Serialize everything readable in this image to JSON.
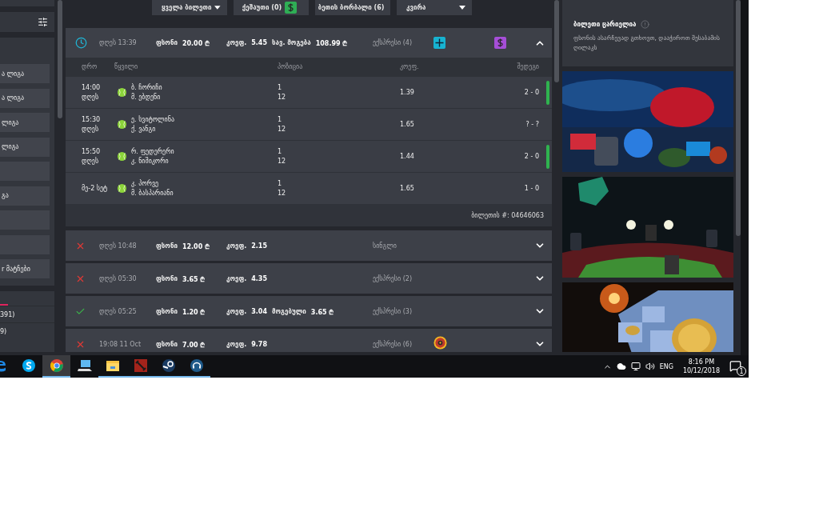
{
  "sidebar": {
    "items": [
      {
        "kind": "league",
        "label": "ა ლიგა"
      },
      {
        "kind": "league",
        "label": "ა ლიგა"
      },
      {
        "kind": "league",
        "label": "ლიგა"
      },
      {
        "kind": "league",
        "label": "ლიგა"
      },
      {
        "kind": "blank"
      },
      {
        "kind": "league",
        "label": "გა"
      },
      {
        "kind": "blank"
      },
      {
        "kind": "blank"
      },
      {
        "kind": "league",
        "label": "r მატჩები"
      }
    ],
    "list": [
      "391)",
      "9)"
    ]
  },
  "filters": [
    {
      "label": "ყველა ბილეთი",
      "kind": "dropdown"
    },
    {
      "label": "ქეშაუთი (0)",
      "kind": "cashout"
    },
    {
      "label": "ბეთის ბორბალი (6)",
      "kind": "plain"
    },
    {
      "label": "კვირა",
      "kind": "dropdown"
    }
  ],
  "tickets": [
    {
      "kind": "pending",
      "expanded": true,
      "date": "დღეს 13:39",
      "stake": {
        "label": "ფსონი",
        "value": "20.00 ₾"
      },
      "odds": {
        "label": "კოეფ.",
        "value": "5.45"
      },
      "payout": {
        "label": "სავ. მოგება",
        "value": "108.99 ₾"
      },
      "type": "ექსპრესი (4)",
      "can_add": true,
      "cashout": true,
      "bonus": false,
      "columns": [
        "დრო",
        "წყვილი",
        "პოზიცია",
        "კოეფ.",
        "შედეგი"
      ],
      "matches": [
        {
          "time": "14:00",
          "day": "დღეს",
          "home": "ბ. ჩორიჩი",
          "away": "მ. ებდენი",
          "pick": "1",
          "market": "12",
          "odds": "1.39",
          "result": "2 - 0",
          "won": true
        },
        {
          "time": "15:30",
          "day": "დღეს",
          "home": "ე. სვიტოლინა",
          "away": "ქ. ვანგი",
          "pick": "1",
          "market": "12",
          "odds": "1.65",
          "result": "? - ?",
          "won": false
        },
        {
          "time": "15:50",
          "day": "დღეს",
          "home": "რ. ფედერერი",
          "away": "კ. ნიშიკორი",
          "pick": "1",
          "market": "12",
          "odds": "1.44",
          "result": "2 - 0",
          "won": true
        },
        {
          "time": "მე-2 სეტ",
          "home": "კ. პორვე",
          "away": "მ. ბასპარიანი",
          "pick": "1",
          "market": "12",
          "odds": "1.65",
          "result": "1 - 0",
          "won": false
        }
      ],
      "footer": "ბილეთის #: 04646063"
    },
    {
      "kind": "lost",
      "expanded": false,
      "date": "დღეს 10:48",
      "stake": {
        "label": "ფსონი",
        "value": "12.00 ₾"
      },
      "odds": {
        "label": "კოეფ.",
        "value": "2.15"
      },
      "type": "სინგლი",
      "can_add": false,
      "cashout": false,
      "bonus": false
    },
    {
      "kind": "lost",
      "expanded": false,
      "date": "დღეს 05:30",
      "stake": {
        "label": "ფსონი",
        "value": "3.65 ₾"
      },
      "odds": {
        "label": "კოეფ.",
        "value": "4.35"
      },
      "type": "ექსპრესი (2)",
      "can_add": false,
      "cashout": false,
      "bonus": false
    },
    {
      "kind": "won",
      "expanded": false,
      "date": "დღეს 05:25",
      "stake": {
        "label": "ფსონი",
        "value": "1.20 ₾"
      },
      "odds": {
        "label": "კოეფ.",
        "value": "3.04"
      },
      "payout": {
        "label": "მოგებული",
        "value": "3.65 ₾"
      },
      "type": "ექსპრესი (3)",
      "can_add": false,
      "cashout": false,
      "bonus": false
    },
    {
      "kind": "lost",
      "expanded": false,
      "date": "19:08 11 Oct",
      "stake": {
        "label": "ფსონი",
        "value": "7.00 ₾"
      },
      "odds": {
        "label": "კოეფ.",
        "value": "9.78"
      },
      "type": "ექსპრესი (6)",
      "can_add": false,
      "cashout": false,
      "bonus": true
    }
  ],
  "betslip": {
    "title": "ბილეთი ცარიელია",
    "message": "ფსონის ასარჩევად გთხოვთ, დააჭიროთ შესაბამის ღილაკს"
  },
  "taskbar": {
    "apps": [
      {
        "selected": false,
        "running": false
      },
      {
        "selected": false,
        "running": false
      },
      {
        "selected": true,
        "running": true
      },
      {
        "selected": false,
        "running": false
      },
      {
        "selected": false,
        "running": true
      },
      {
        "selected": false,
        "running": true
      },
      {
        "selected": false,
        "running": true
      },
      {
        "selected": false,
        "running": true
      }
    ],
    "language": "ENG",
    "time": "8:16 PM",
    "date": "10/12/2018",
    "notifications": "1"
  }
}
